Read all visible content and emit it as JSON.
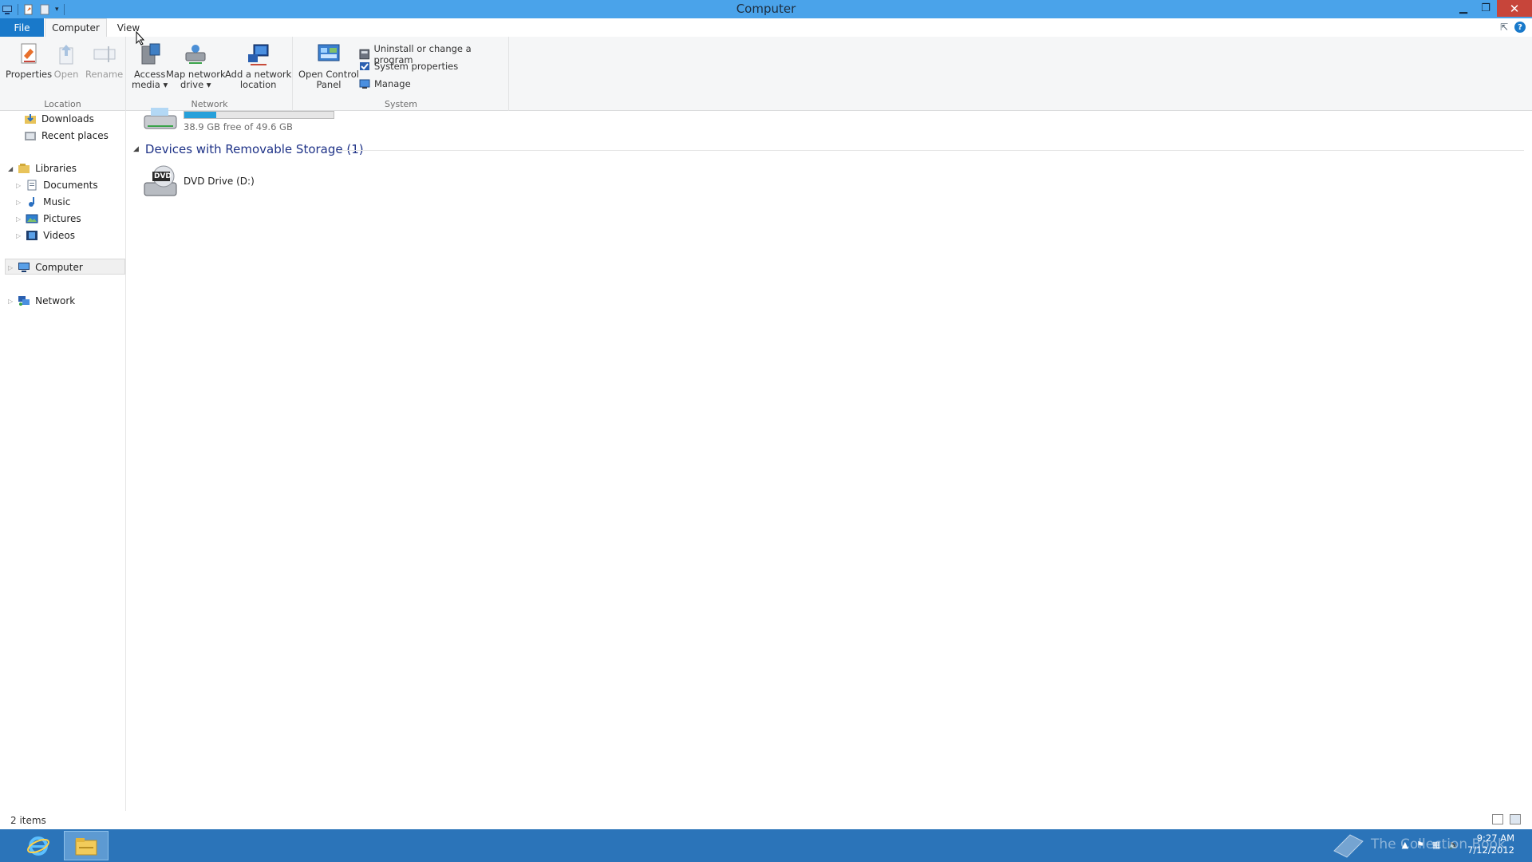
{
  "window": {
    "title": "Computer"
  },
  "tabs": {
    "file": "File",
    "computer": "Computer",
    "view": "View"
  },
  "ribbon": {
    "location_group": {
      "label": "Location",
      "properties": "Properties",
      "open": "Open",
      "rename": "Rename"
    },
    "network_group": {
      "label": "Network",
      "access_media_line1": "Access",
      "access_media_line2": "media ▾",
      "map_drive_line1": "Map network",
      "map_drive_line2": "drive ▾",
      "add_location_line1": "Add a network",
      "add_location_line2": "location"
    },
    "system_group": {
      "label": "System",
      "open_cp_line1": "Open Control",
      "open_cp_line2": "Panel",
      "uninstall": "Uninstall or change a program",
      "system_properties": "System properties",
      "manage": "Manage"
    }
  },
  "nav": {
    "downloads": "Downloads",
    "recent_places": "Recent places",
    "libraries": "Libraries",
    "documents": "Documents",
    "music": "Music",
    "pictures": "Pictures",
    "videos": "Videos",
    "computer": "Computer",
    "network": "Network"
  },
  "content": {
    "drive_usage": {
      "free_text": "38.9 GB free of 49.6 GB",
      "used_fraction": 0.216
    },
    "removable_header": "Devices with Removable Storage (1)",
    "dvd_drive": "DVD Drive (D:)",
    "dvd_badge": "DVD"
  },
  "status": {
    "item_count": "2 items"
  },
  "taskbar": {
    "time": "9:27 AM",
    "date": "7/12/2012",
    "watermark": "The Collection Book"
  },
  "colors": {
    "titlebar": "#4aa3ea",
    "file_tab": "#1979ca",
    "close": "#c7453a",
    "taskbar": "#2b74b9",
    "usage_fill": "#26a0da"
  }
}
